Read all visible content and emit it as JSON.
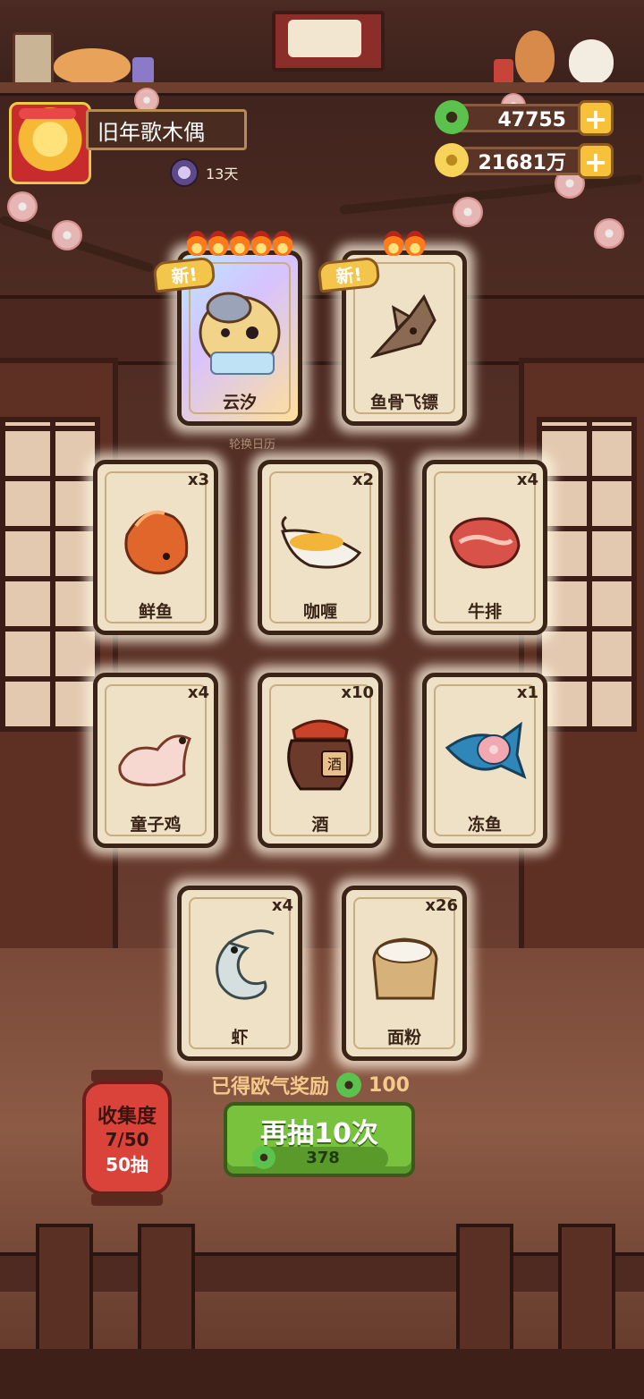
{
  "player": {
    "name": "旧年歌木偶",
    "days": "13天"
  },
  "currency": {
    "jade": "47755",
    "coins": "21681万"
  },
  "hint": "轮换日历",
  "featured": [
    {
      "name": "云汐",
      "tag": "新!",
      "flames": 5
    },
    {
      "name": "鱼骨飞镖",
      "tag": "新!",
      "flames": 2
    }
  ],
  "items": [
    {
      "name": "鲜鱼",
      "count": "x3"
    },
    {
      "name": "咖喱",
      "count": "x2"
    },
    {
      "name": "牛排",
      "count": "x4"
    },
    {
      "name": "童子鸡",
      "count": "x4"
    },
    {
      "name": "酒",
      "count": "x10"
    },
    {
      "name": "冻鱼",
      "count": "x1"
    },
    {
      "name": "虾",
      "count": "x4"
    },
    {
      "name": "面粉",
      "count": "x26"
    }
  ],
  "jar_label": "酒",
  "collection": {
    "title": "收集度",
    "progress": "7/50",
    "draws": "50抽"
  },
  "reward": {
    "label": "已得欧气奖励",
    "amount": "100"
  },
  "draw_button": {
    "label": "再抽10次",
    "cost": "378"
  }
}
